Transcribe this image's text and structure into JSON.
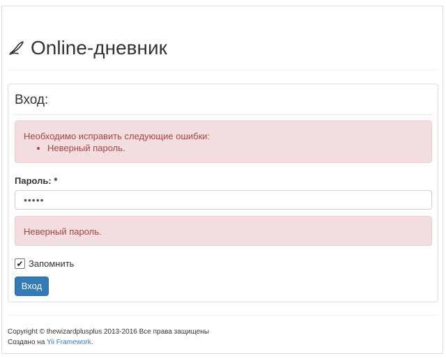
{
  "header": {
    "brand_title": "Online-дневник",
    "brand_icon": "quill-pen-icon"
  },
  "login": {
    "legend": "Вход:",
    "error_summary": {
      "title": "Необходимо исправить следующие ошибки:",
      "items": [
        "Неверный пароль."
      ]
    },
    "password_label": "Пароль: *",
    "password_value": "•••••",
    "password_error": "Неверный пароль.",
    "remember_label": "Запомнить",
    "remember_checked": true,
    "submit_label": "Вход"
  },
  "footer": {
    "copyright": "Copyright © thewizardplusplus 2013-2016 Все права защищены",
    "created_prefix": "Создано на ",
    "framework_link": "Yii Framework",
    "created_suffix": "."
  },
  "colors": {
    "primary": "#337ab7",
    "error_text": "#a94442",
    "error_bg": "#f2dede"
  }
}
